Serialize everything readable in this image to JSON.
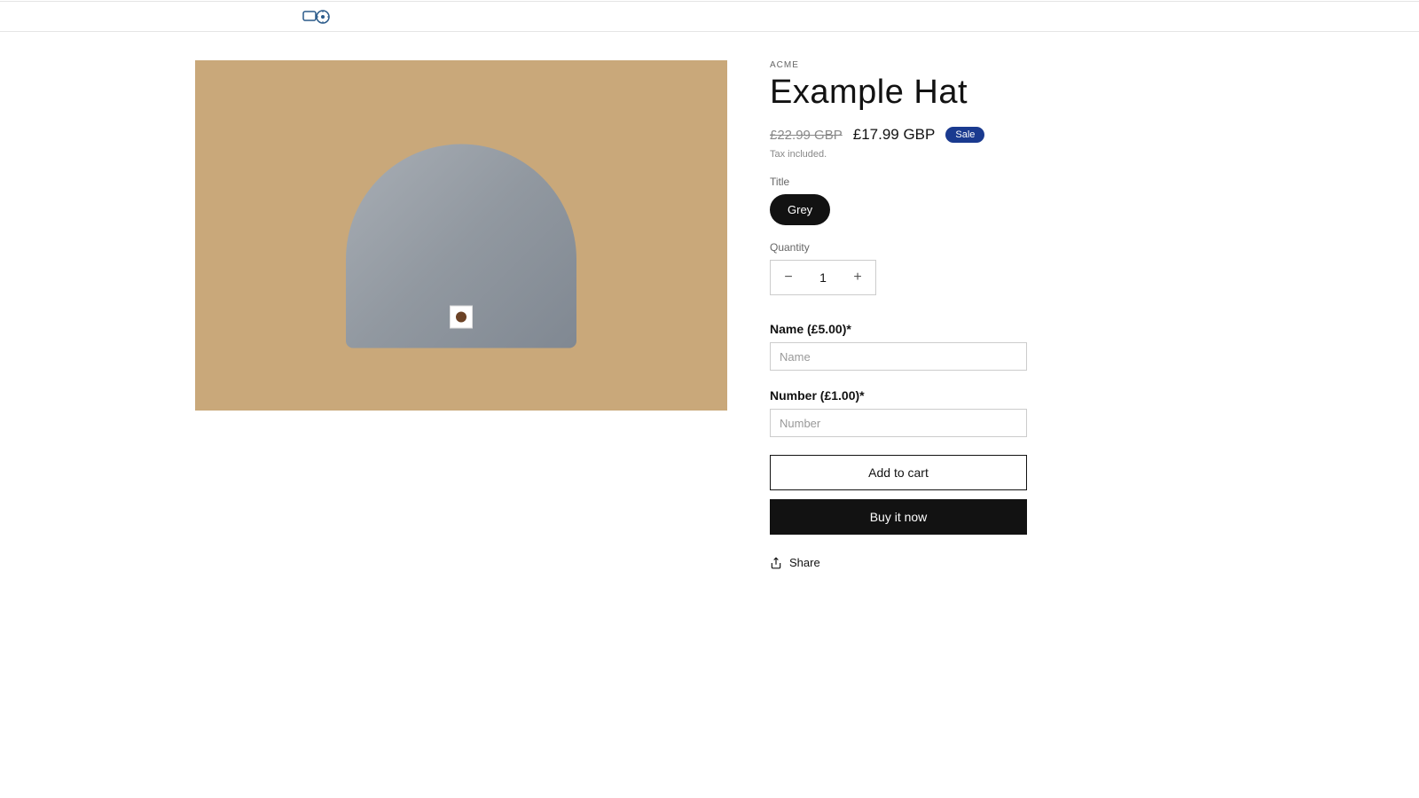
{
  "vendor": "ACME",
  "product_title": "Example Hat",
  "price": {
    "old": "£22.99 GBP",
    "sale": "£17.99 GBP",
    "badge": "Sale"
  },
  "tax_note": "Tax included.",
  "variant": {
    "label": "Title",
    "option": "Grey"
  },
  "quantity": {
    "label": "Quantity",
    "value": "1",
    "minus": "−",
    "plus": "+"
  },
  "custom_fields": [
    {
      "label": "Name (£5.00)*",
      "placeholder": "Name"
    },
    {
      "label": "Number (£1.00)*",
      "placeholder": "Number"
    }
  ],
  "buttons": {
    "add_to_cart": "Add to cart",
    "buy_now": "Buy it now"
  },
  "share": "Share"
}
